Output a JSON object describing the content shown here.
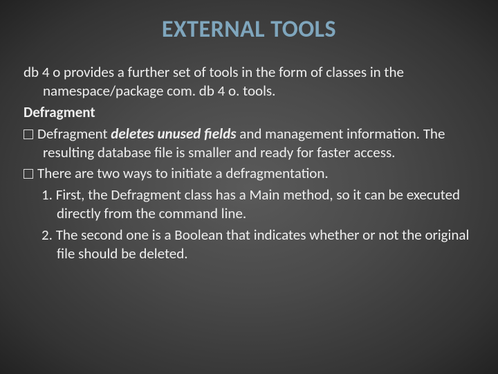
{
  "title": "EXTERNAL TOOLS",
  "intro_lead": "db 4 o ",
  "intro_rest": "provides a further set of tools in the form of classes in the namespace/package com. db 4 o. tools.",
  "subheading": "Defragment",
  "b1_before": "Defragment ",
  "b1_em": "deletes unused fields",
  "b1_after": " and management information. The resulting database file is smaller and ready for faster access.",
  "b2": "There are two ways to initiate a defragmentation.",
  "n1": "1. First, the Defragment class has a Main method, so it can be executed directly from the command line.",
  "n2": "2. The second one is a Boolean that indicates whether or not the original file should be deleted."
}
